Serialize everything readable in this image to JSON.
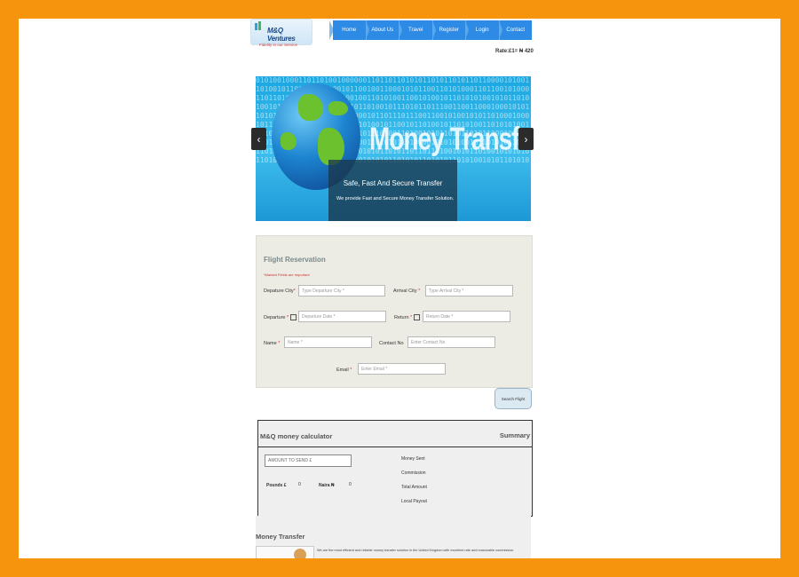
{
  "brand": {
    "name": "M&Q Ventures",
    "tagline": "Fidelity in our Service"
  },
  "nav": {
    "items": [
      "Home",
      "About Us",
      "Travel",
      "Register",
      "Login",
      "Contact"
    ]
  },
  "rate": "Rate:£1= ₦ 420",
  "slider": {
    "title": "Money Transfer",
    "caption_title": "Safe, Fast And Secure Transfer",
    "caption_sub": "We provide Fast and  Secure Money Transfer Solution.",
    "prev": "‹",
    "next": "›"
  },
  "flight": {
    "heading": "Flight Reservation",
    "required_note": "*Marked Fields are Important",
    "departure_city_label": "Depature City",
    "departure_city_ph": "Type Departure City *",
    "arrival_city_label": "Arrival City",
    "arrival_city_ph": "Type Arrival City *",
    "departure_label": "Departure",
    "departure_ph": "Departure Date *",
    "return_label": "Return",
    "return_ph": "Return Date *",
    "name_label": "Name",
    "name_ph": "Name *",
    "contact_label": "Contact No",
    "contact_ph": "Enter Contact No",
    "email_label": "Email",
    "email_ph": "Enter Email *",
    "star": "*",
    "search_button": "Search Flight"
  },
  "calculator": {
    "title": "M&Q money calculator",
    "summary": "Summary",
    "amount_ph": "AMOUNT TO SEND £",
    "pounds_label": "Pounds £",
    "pounds_value": "0",
    "naira_label": "Naira ₦",
    "naira_value": "0",
    "summary_items": [
      "Money Sent",
      "Commission",
      "Total Amount",
      "Local Payout"
    ]
  },
  "money_transfer": {
    "heading": "Money Transfer",
    "text": "We are the most efficient and reliable money transfer solution in the United Kingdom with excellent rate and reasonable commission."
  }
}
